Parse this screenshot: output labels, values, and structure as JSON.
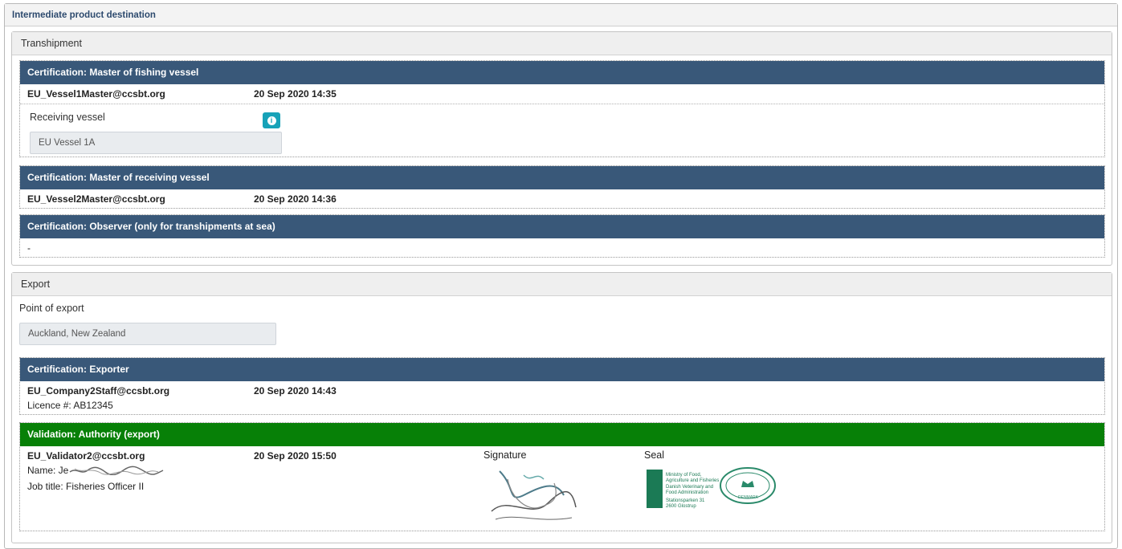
{
  "section": {
    "title": "Intermediate product destination"
  },
  "transhipment": {
    "title": "Transhipment",
    "master_fishing": {
      "heading": "Certification:  Master of fishing vessel",
      "email": "EU_Vessel1Master@ccsbt.org",
      "date": "20 Sep 2020 14:35",
      "receiving_vessel_label": "Receiving vessel",
      "receiving_vessel_value": "EU Vessel 1A",
      "info_icon": "info-circle-icon"
    },
    "master_receiving": {
      "heading": "Certification:  Master of receiving vessel",
      "email": "EU_Vessel2Master@ccsbt.org",
      "date": "20 Sep 2020 14:36"
    },
    "observer": {
      "heading": "Certification:  Observer (only for transhipments at sea)",
      "value": "-"
    }
  },
  "export": {
    "title": "Export",
    "point_label": "Point of export",
    "point_value": "Auckland, New Zealand",
    "exporter": {
      "heading": "Certification:  Exporter",
      "email": "EU_Company2Staff@ccsbt.org",
      "date": "20 Sep 2020 14:43",
      "licence": "Licence #: AB12345"
    },
    "validation": {
      "heading": "Validation:  Authority (export)",
      "email": "EU_Validator2@ccsbt.org",
      "date": "20 Sep 2020 15:50",
      "name_label": "Name: Je",
      "job_title": "Job title: Fisheries Officer II",
      "signature_label": "Signature",
      "seal_label": "Seal",
      "seal_text": [
        "Ministry of Food,",
        "Agriculture and Fisheries",
        "Danish Veterinary and",
        "Food Administration",
        "Stationsparken 31",
        "2600 Glostrup"
      ],
      "stamp_text": "DENMARK"
    }
  },
  "colors": {
    "cert_bar": "#395879",
    "validation_bar": "#078007",
    "info_button": "#17a2b8"
  }
}
